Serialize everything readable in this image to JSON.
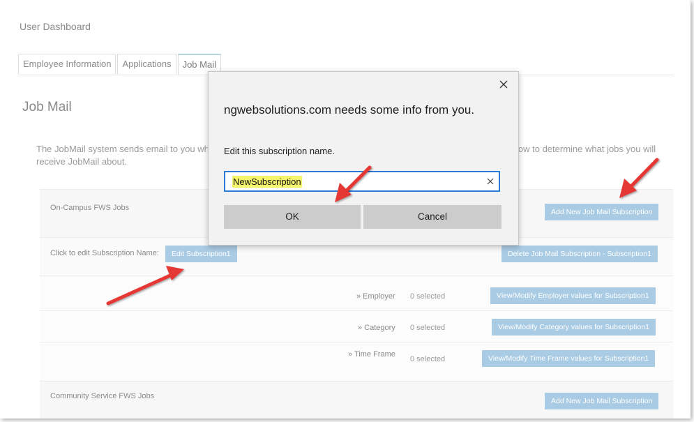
{
  "page": {
    "title": "User Dashboard"
  },
  "tabs": [
    {
      "label": "Employee Information",
      "active": false
    },
    {
      "label": "Applications",
      "active": false
    },
    {
      "label": "Job Mail",
      "active": true
    }
  ],
  "section": {
    "title": "Job Mail",
    "intro_left": "The JobMail system sends email to you wh receive JobMail about.",
    "intro_right": "low to determine what jobs you will"
  },
  "panels": {
    "oncampus": {
      "label": "On-Campus FWS Jobs",
      "add_button": "Add New Job Mail Subscription"
    },
    "edit_row": {
      "label": "Click to edit Subscription Name:",
      "edit_button": "Edit Subscription1",
      "delete_button": "Delete Job Mail Subscription - Subscription1"
    },
    "criteria": [
      {
        "label": "» Employer",
        "value": "0 selected",
        "button": "View/Modify Employer values for Subscription1"
      },
      {
        "label": "» Category",
        "value": "0 selected",
        "button": "View/Modify Category values for Subscription1"
      },
      {
        "label": "» Time Frame",
        "value": "0 selected",
        "button": "View/Modify Time Frame values for Subscription1"
      }
    ],
    "community": {
      "label": "Community Service FWS Jobs",
      "add_button": "Add New Job Mail Subscription"
    }
  },
  "dialog": {
    "heading": "ngwebsolutions.com needs some info from you.",
    "prompt": "Edit this subscription name.",
    "input_value": "NewSubscription",
    "ok_label": "OK",
    "cancel_label": "Cancel",
    "close_icon": "close-icon"
  },
  "colors": {
    "button_blue": "#a9cbe3",
    "arrow_red": "#e53935",
    "input_focus": "#2d7ad6",
    "highlight": "#f4f46a"
  }
}
